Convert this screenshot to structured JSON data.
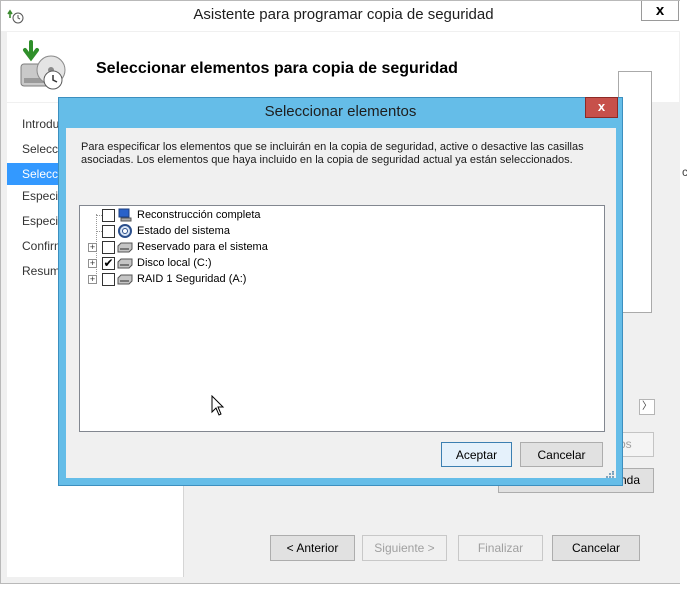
{
  "wizard": {
    "title": "Asistente para programar copia de seguridad",
    "close_glyph": "x",
    "heading": "Seleccionar elementos para copia de seguridad",
    "steps": [
      "Introdu",
      "Selecci",
      "Selecci",
      "Especif",
      "Especif",
      "Confirm",
      "Resum"
    ],
    "selected_step_index": 2,
    "bg_button_1": "os",
    "bg_button_2": "nda",
    "right_edge_fragment": "c",
    "buttons": {
      "back": "< Anterior",
      "next": "Siguiente >",
      "finish": "Finalizar",
      "cancel": "Cancelar"
    }
  },
  "dialog": {
    "title": "Seleccionar elementos",
    "close_glyph": "x",
    "description": "Para especificar los elementos que se incluirán en la copia de seguridad, active o desactive las casillas asociadas. Los elementos que haya incluido en la copia de seguridad actual ya están seleccionados.",
    "tree": [
      {
        "label": "Reconstrucción completa",
        "checked": false,
        "expandable": false,
        "icon": "bare-metal-recovery-icon"
      },
      {
        "label": "Estado del sistema",
        "checked": false,
        "expandable": false,
        "icon": "system-state-icon"
      },
      {
        "label": "Reservado para el sistema",
        "checked": false,
        "expandable": true,
        "icon": "drive-icon"
      },
      {
        "label": "Disco local (C:)",
        "checked": true,
        "expandable": true,
        "icon": "drive-icon"
      },
      {
        "label": "RAID 1 Seguridad (A:)",
        "checked": false,
        "expandable": true,
        "icon": "drive-icon"
      }
    ],
    "buttons": {
      "ok": "Aceptar",
      "cancel": "Cancelar"
    }
  },
  "colors": {
    "dialog_frame": "#65bde8",
    "dialog_close": "#c7504a",
    "selection": "#3399ff"
  }
}
